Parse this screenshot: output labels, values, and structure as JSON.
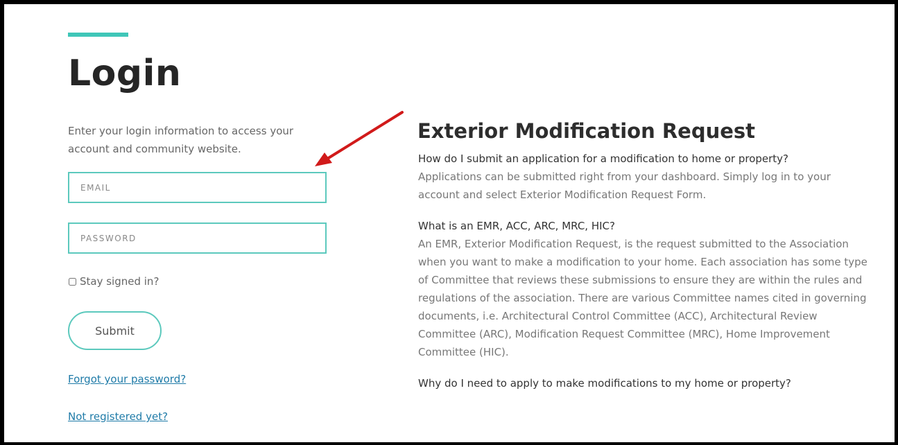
{
  "login": {
    "title": "Login",
    "intro": "Enter your login information to access your account and community website.",
    "email_placeholder": "EMAIL",
    "password_placeholder": "PASSWORD",
    "stay_signed_in": "Stay signed in?",
    "submit_label": "Submit",
    "forgot_link": "Forgot your password?",
    "register_link": "Not registered yet?"
  },
  "info": {
    "title": "Exterior Modification Request",
    "faqs": [
      {
        "question": "How do I submit an application for a modification to home or property?",
        "answer": "Applications can be submitted right from your dashboard. Simply log in to your account and select Exterior Modification Request Form."
      },
      {
        "question": "What is an EMR, ACC, ARC, MRC, HIC?",
        "answer": "An EMR, Exterior Modification Request, is the request submitted to the Association when you want to make a modification to your home. Each association has some type of Committee that reviews these submissions to ensure they are within the rules and regulations of the association. There are various Committee names cited in governing documents, i.e. Architectural Control Committee (ACC), Architectural Review Committee (ARC), Modification Request Committee (MRC), Home Improvement Committee (HIC)."
      },
      {
        "question": "Why do I need to apply to make modifications to my home or property?",
        "answer": ""
      }
    ]
  },
  "colors": {
    "accent": "#3fc6b8",
    "link": "#1f7ba8",
    "annotation_arrow": "#d11a1a"
  },
  "icons": {
    "annotation": "red-arrow-icon"
  }
}
